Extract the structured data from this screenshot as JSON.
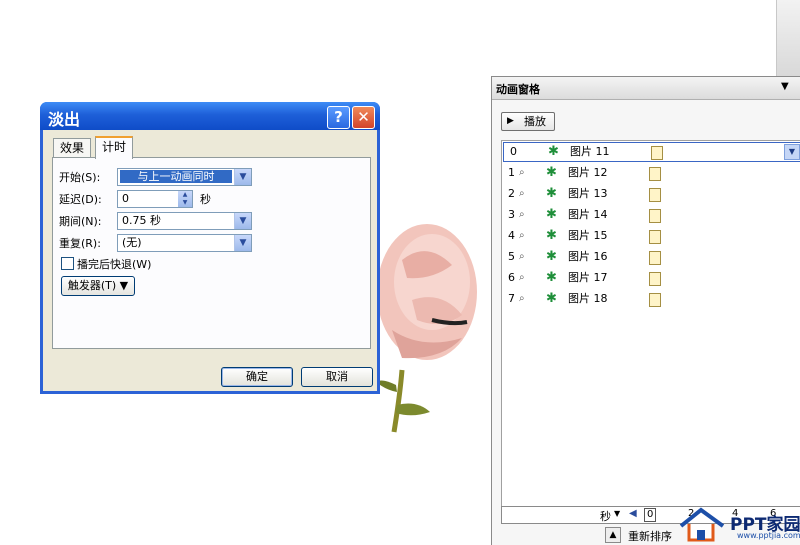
{
  "dialog": {
    "title": "淡出",
    "help_button": "?",
    "close_button": "✕",
    "tabs": [
      {
        "label": "效果",
        "active": false
      },
      {
        "label": "计时",
        "active": true
      }
    ],
    "start": {
      "label": "开始(S):",
      "value": "与上一动画同时"
    },
    "delay": {
      "label": "延迟(D):",
      "value": "0",
      "unit": "秒"
    },
    "duration": {
      "label": "期间(N):",
      "value": "0.75 秒"
    },
    "repeat": {
      "label": "重复(R):",
      "value": "(无)"
    },
    "rewind": {
      "label": "播完后快退(W)",
      "checked": false
    },
    "trigger_button": "触发器(T) ▼",
    "ok": "确定",
    "cancel": "取消"
  },
  "pane": {
    "title": "动画窗格",
    "play_button": "播放",
    "items": [
      {
        "num": "0",
        "name": "图片 11",
        "selected": true
      },
      {
        "num": "1",
        "name": "图片 12",
        "selected": false
      },
      {
        "num": "2",
        "name": "图片 13",
        "selected": false
      },
      {
        "num": "3",
        "name": "图片 14",
        "selected": false
      },
      {
        "num": "4",
        "name": "图片 15",
        "selected": false
      },
      {
        "num": "5",
        "name": "图片 16",
        "selected": false
      },
      {
        "num": "6",
        "name": "图片 17",
        "selected": false
      },
      {
        "num": "7",
        "name": "图片 18",
        "selected": false
      }
    ],
    "timeline": {
      "unit": "秒",
      "ticks": [
        "0",
        "2",
        "4",
        "6"
      ]
    },
    "reorder_label": "重新排序"
  },
  "watermark": {
    "text": "PPT家园",
    "url": "www.pptjia.com"
  },
  "colors": {
    "title_blue": "#1e5fd8",
    "selection": "#316ac5",
    "star_green": "#1f8f3a",
    "dialog_face": "#ece9d8"
  }
}
